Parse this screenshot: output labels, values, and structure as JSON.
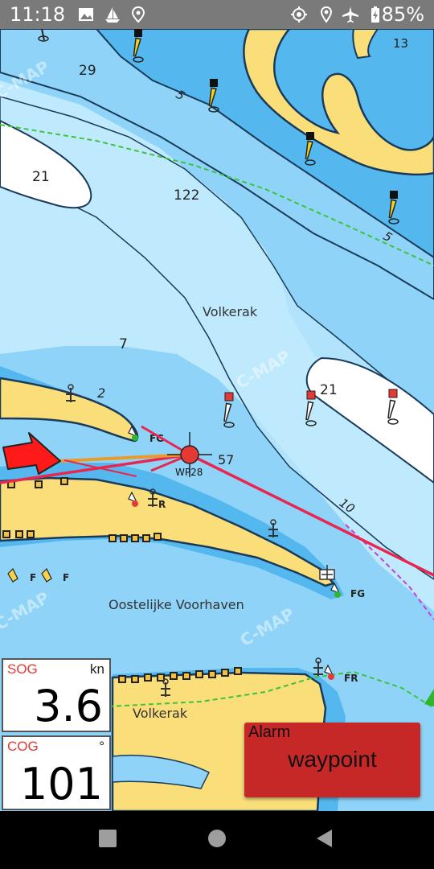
{
  "status_bar": {
    "time": "11:18",
    "battery": "85%",
    "left_icons": [
      "image-icon",
      "sailboat-icon",
      "location-pin-icon"
    ],
    "right_icons": [
      "gps-crosshair-icon",
      "location-icon",
      "airplane-icon",
      "battery-icon"
    ]
  },
  "chart": {
    "place_labels": [
      "Volkerak",
      "Oostelijke Voorhaven",
      "Volkerak"
    ],
    "depths": [
      "29",
      "13",
      "21",
      "122",
      "7",
      "2",
      "21",
      "57",
      "10",
      "5",
      "5"
    ],
    "light_labels": [
      "FG",
      "R",
      "FG",
      "F",
      "F",
      "FR"
    ],
    "waypoint": "WP28",
    "watermark": "C-MAP",
    "colors": {
      "deep": "#54b8ef",
      "mid": "#8fd4f8",
      "shallow": "#bfe9fd",
      "land": "#f9de7a",
      "route": "#e8264f",
      "course": "#ff3333"
    }
  },
  "instruments": {
    "sog": {
      "label": "SOG",
      "unit": "kn",
      "value": "3.6"
    },
    "cog": {
      "label": "COG",
      "unit": "°",
      "value": "101"
    }
  },
  "alarm": {
    "title": "Alarm",
    "message": "waypoint"
  },
  "nav": [
    "recents-button",
    "home-button",
    "back-button"
  ]
}
